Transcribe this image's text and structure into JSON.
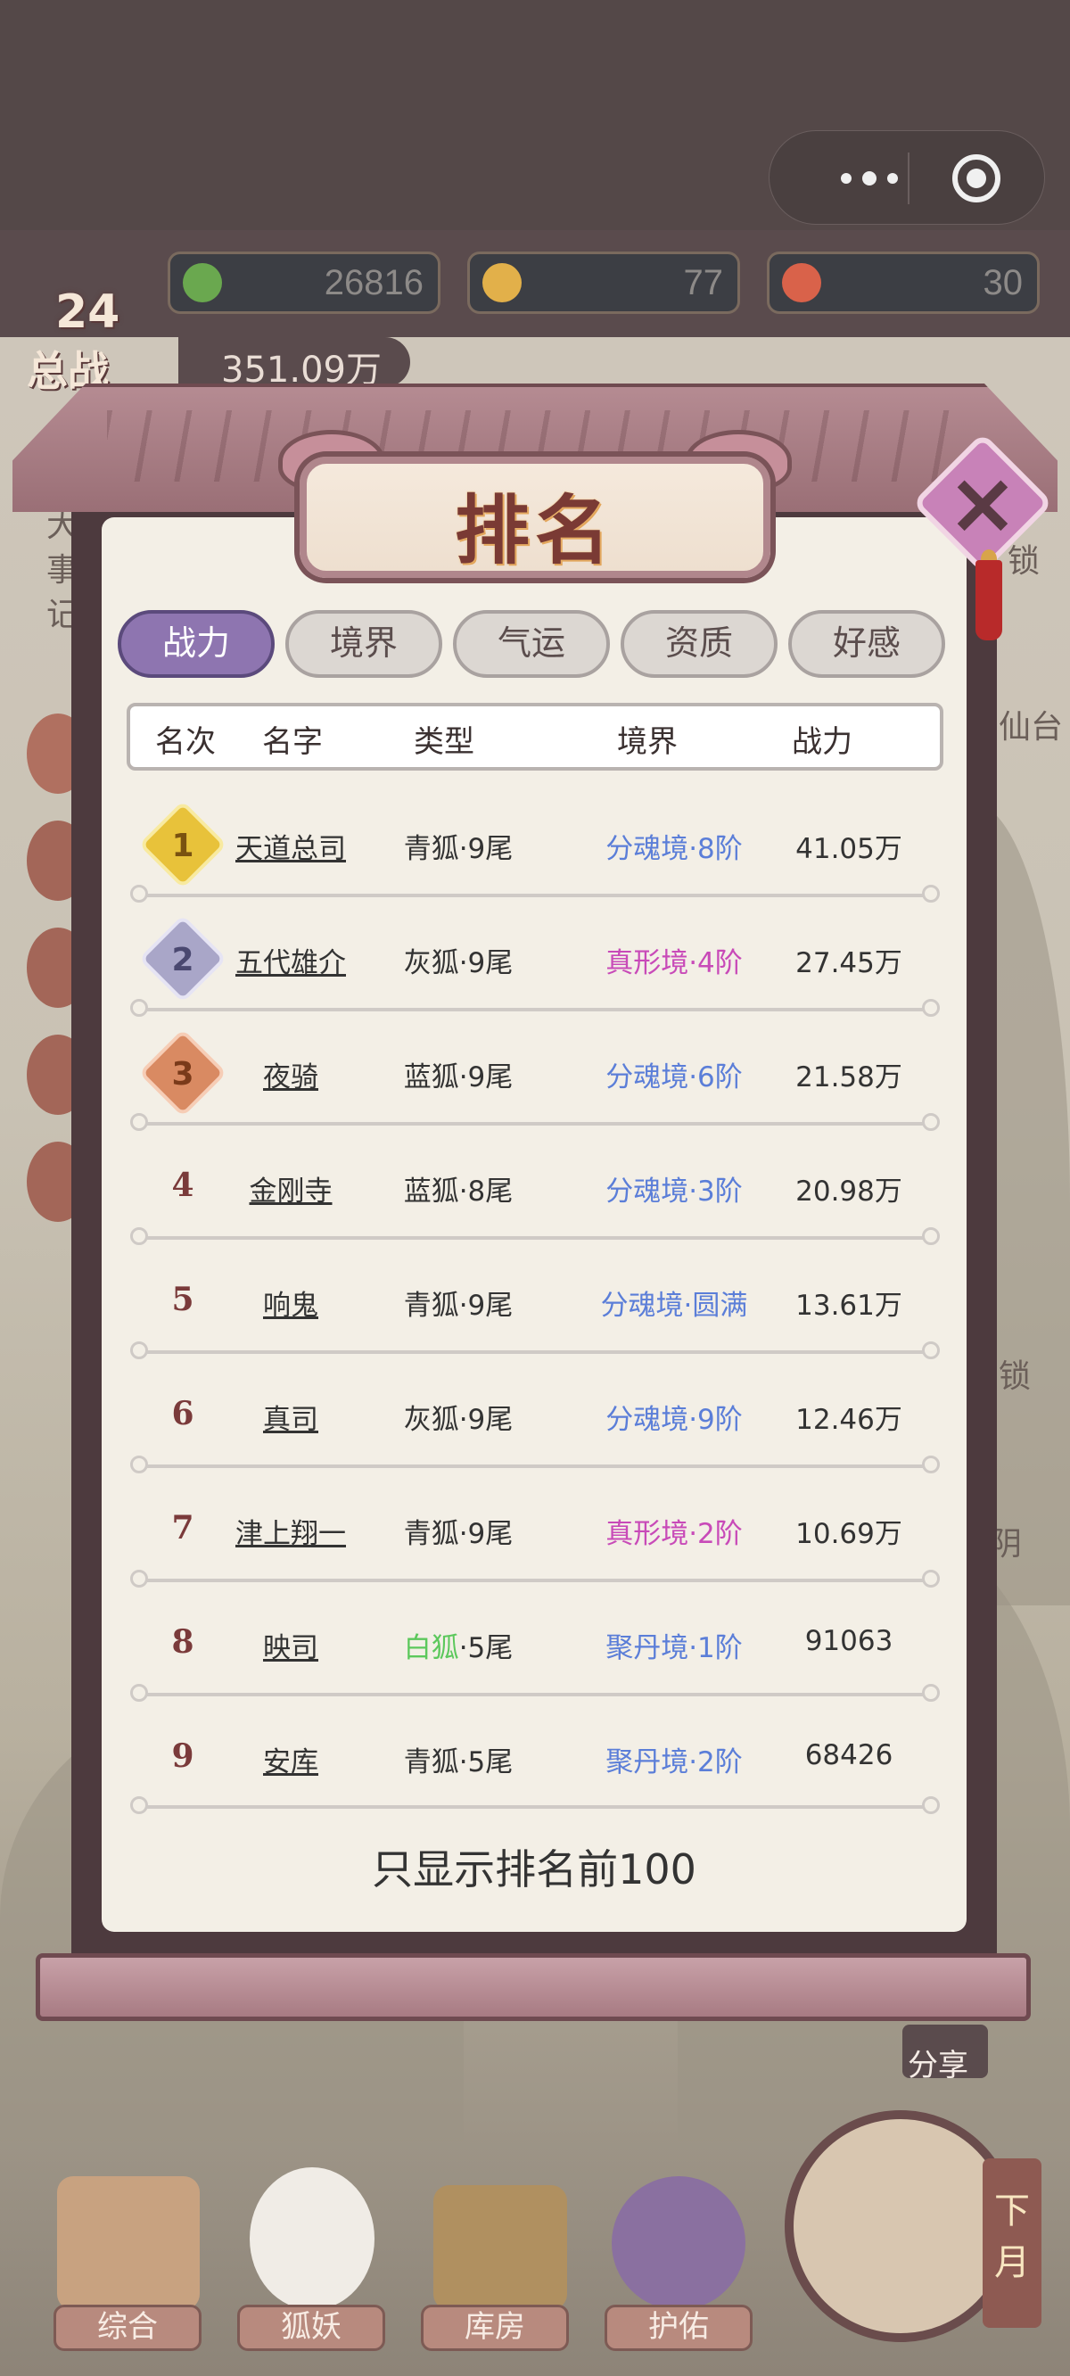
{
  "resources": [
    {
      "value": "26816",
      "icon": "jade-icon",
      "color": "#6aa84f"
    },
    {
      "value": "77",
      "icon": "gold-ingot-icon",
      "color": "#e2b04a"
    },
    {
      "value": "30",
      "icon": "peach-icon",
      "color": "#d9624a"
    }
  ],
  "player": {
    "level": "24",
    "power_label": "总战",
    "power_value": "351.09万"
  },
  "side_texts": {
    "left_a": "大",
    "left_b": "事",
    "left_c": "记",
    "right_a": "锁",
    "right_b": "仙台",
    "right_c": "锁",
    "right_d": "阴"
  },
  "share_label": "分享",
  "month_button": "下\n月",
  "nav": [
    {
      "label": "综合",
      "icon": "shrine-icon"
    },
    {
      "label": "狐妖",
      "icon": "fox-mask-icon"
    },
    {
      "label": "库房",
      "icon": "storage-icon"
    },
    {
      "label": "护佑",
      "icon": "lotus-icon"
    }
  ],
  "modal": {
    "title": "排名",
    "tabs": [
      "战力",
      "境界",
      "气运",
      "资质",
      "好感"
    ],
    "active_tab": "战力",
    "columns": [
      "名次",
      "名字",
      "类型",
      "境界",
      "战力"
    ],
    "rows": [
      {
        "rank": "1",
        "name": "天道总司",
        "type": "青狐·9尾",
        "realm": "分魂境·8阶",
        "power": "41.05万"
      },
      {
        "rank": "2",
        "name": "五代雄介",
        "type": "灰狐·9尾",
        "realm": "真形境·4阶",
        "power": "27.45万"
      },
      {
        "rank": "3",
        "name": "夜骑",
        "type": "蓝狐·9尾",
        "realm": "分魂境·6阶",
        "power": "21.58万"
      },
      {
        "rank": "4",
        "name": "金刚寺",
        "type": "蓝狐·8尾",
        "realm": "分魂境·3阶",
        "power": "20.98万"
      },
      {
        "rank": "5",
        "name": "响鬼",
        "type": "青狐·9尾",
        "realm": "分魂境·圆满",
        "power": "13.61万"
      },
      {
        "rank": "6",
        "name": "真司",
        "type": "灰狐·9尾",
        "realm": "分魂境·9阶",
        "power": "12.46万"
      },
      {
        "rank": "7",
        "name": "津上翔一",
        "type": "青狐·9尾",
        "realm": "真形境·2阶",
        "power": "10.69万"
      },
      {
        "rank": "8",
        "name": "映司",
        "type_a": "白狐",
        "type_b": "·5尾",
        "realm": "聚丹境·1阶",
        "power": "91063"
      },
      {
        "rank": "9",
        "name": "安库",
        "type": "青狐·5尾",
        "realm": "聚丹境·2阶",
        "power": "68426"
      }
    ],
    "footnote": "只显示排名前100"
  },
  "colors": {
    "realm_blue": "#5b7ed8",
    "realm_pink": "#c84ab8",
    "white_fox": "#5cc85c",
    "gold": "#e8c23a",
    "silver": "#a9a6c8",
    "bronze": "#d98a62"
  }
}
